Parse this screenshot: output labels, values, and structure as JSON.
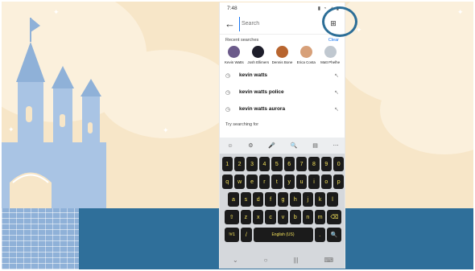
{
  "status": {
    "time": "7:48",
    "icons": "▮ ◔ ⊿ ▮"
  },
  "search": {
    "placeholder": "Search",
    "back_icon": "arrow-left-icon",
    "scan_icon": "scan-icon"
  },
  "recent": {
    "title": "Recent searches",
    "clear": "Clear",
    "people": [
      {
        "name": "Kevin Watts",
        "color": "#6b5a8a"
      },
      {
        "name": "Josh Ellimers",
        "color": "#1d1d2a"
      },
      {
        "name": "Dennis Bone",
        "color": "#b8652f"
      },
      {
        "name": "Erica Costa",
        "color": "#d7a079"
      },
      {
        "name": "Matt Phelhe",
        "color": "#c0c8d0"
      }
    ]
  },
  "history": [
    {
      "text": "kevin watts"
    },
    {
      "text": "kevin watts police"
    },
    {
      "text": "kevin watts aurora"
    }
  ],
  "try_label": "Try searching for",
  "keyboard": {
    "toolbar": [
      "☺",
      "⚙",
      "🎤",
      "🔍",
      "▤",
      "⋯"
    ],
    "row_numbers": [
      "1",
      "2",
      "3",
      "4",
      "5",
      "6",
      "7",
      "8",
      "9",
      "0"
    ],
    "row1": [
      "q",
      "w",
      "e",
      "r",
      "t",
      "y",
      "u",
      "i",
      "o",
      "p"
    ],
    "row2": [
      "a",
      "s",
      "d",
      "f",
      "g",
      "h",
      "j",
      "k",
      "l"
    ],
    "row3": [
      "z",
      "x",
      "c",
      "v",
      "b",
      "n",
      "m"
    ],
    "shift": "⇧",
    "backspace": "⌫",
    "symbols": "!#1",
    "slash": "/",
    "space": "English (US)",
    "period": ".",
    "search_key": "🔍"
  },
  "nav": {
    "down": "⌄",
    "home": "○",
    "recents": "|||",
    "keyboard": "⌨"
  }
}
